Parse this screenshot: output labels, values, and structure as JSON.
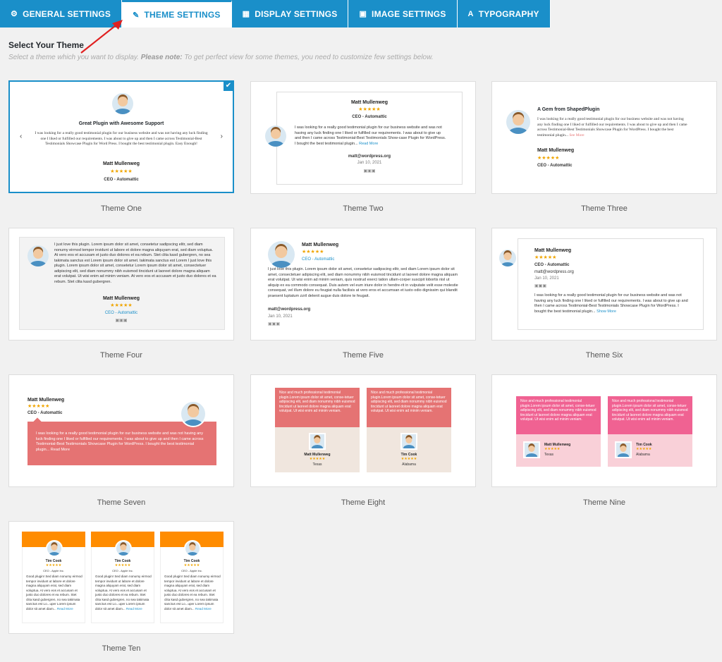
{
  "tabs": [
    {
      "label": "GENERAL SETTINGS",
      "icon": "gear-icon"
    },
    {
      "label": "THEME SETTINGS",
      "icon": "wand-icon"
    },
    {
      "label": "DISPLAY SETTINGS",
      "icon": "grid-icon"
    },
    {
      "label": "IMAGE SETTINGS",
      "icon": "image-icon"
    },
    {
      "label": "TYPOGRAPHY",
      "icon": "font-icon"
    }
  ],
  "section": {
    "title": "Select Your Theme",
    "desc_prefix": "Select a theme which you want to display.",
    "desc_bold": "Please note:",
    "desc_suffix": "To get perfect view for some themes, you need to customize few settings below."
  },
  "themes": [
    {
      "label": "Theme One",
      "title": "Great Plugin with Awesome Support",
      "text": "I was looking for a really good testimonial plugin for our business website and was not having any luck finding one I liked or fulfilled our requirements. I was about to give up and then I came across Testimonial-Best Testimonials Showcase Plugin for Word Press. I bought the best testimonial plugin. Easy Enough!",
      "name": "Matt Mullenweg",
      "role": "CEO - Automattic"
    },
    {
      "label": "Theme Two",
      "name": "Matt Mullenweg",
      "role": "CEO - Automattic",
      "text": "I was looking for a really good testimonial plugin for our business website and was not having any luck finding one I liked or fulfilled our requirements. I was about to give up and then I came across Testimonial-Best Testimonials Show-case Plugin for WordPress. I bought the best testimonial plugin...",
      "more": "Read More",
      "email": "matt@wordpress.org",
      "date": "Jan 10, 2021"
    },
    {
      "label": "Theme Three",
      "title": "A Gem from ShapedPlugin",
      "text": "I was looking for a really good testimonial plugin for our business website and was not having any luck finding one I liked or fulfilled our requirements. I was about to give up and then I came across Testimonial-Best Testimonials Showcase Plugin for WordPress. I bought the best testimonial plugin...",
      "more": "See More",
      "name": "Matt Mullenweg",
      "role": "CEO - Automattic"
    },
    {
      "label": "Theme Four",
      "text": "I just love this plugin. Lorem ipsum dolor sit amet, consetetur sadipscing elitr, sed diam nonumy eirmod tempor invidunt ut labore et dolore magna aliquyam erat, sed diam voluptua. At vero eos et accusam et justo duo dolores et ea rebum. Stet clita kasd gubergren, no sea takimata sanctus est Lorem ipsum dolor sit amet. takimata sanctus est Lorem I just love this plugin. Lorem ipsum dolor sit amet, consetetur Lorem ipsum dolor sit amet, consectetuer adipiscing elit, sed diam nonummy nibh euismod tincidunt ut laoreet dolore magna aliquam erat volutpat. Ut wisi enim ad minim veniam. At vero eos et accusam et justo duo dolores et ea rebum. Stet clita kasd gubergren.",
      "name": "Matt Mullenweg",
      "role": "CEO - Automattic"
    },
    {
      "label": "Theme Five",
      "name": "Matt Mullenweg",
      "role": "CEO - Automattic",
      "text": "I just love this plugin. Lorem ipsum dolor sit amet, consetetur sadipscing elitr, sed diam Lorem ipsum dolor sit amet, consectetuer adipiscing elit, sed diam nonummy nibh euismod tincidunt ut laoreet dolore magna aliquam erat volutpat. Ut wisi enim ad minim veniam, quis nostrud exerci tation ullam-corper suscipit lobortis nisl ut aliquip ex ea commodo consequat. Duis autem vel eum iriure dolor in hendre-rit in vulputate velit esse molestie consequat, vel illum dolore eu feugiat nulla facilisis at vero eros et accumsan et iusto odio dignissim qui blandit praesent luptatum zzril delenit augue duis dolore te feugait.",
      "email": "matt@wordpress.org",
      "date": "Jan 10, 2021"
    },
    {
      "label": "Theme Six",
      "name": "Matt Mullenweg",
      "role": "CEO - Automattic",
      "email": "matt@wordpress.org",
      "date": "Jan 10, 2021",
      "text": "I was looking for a really good testimonial plugin for our business website and was not having any luck finding one I liked or fulfilled our requirements. I was about to give up and then I came across Testimonial-Best Testimonials Showcase Plugin for WordPress. I bought the best testimonial plugin...",
      "more": "Show More"
    },
    {
      "label": "Theme Seven",
      "name": "Matt Mullenweg",
      "role": "CEO - Automattic",
      "text": "I was looking for a really good testimonial plugin for our business website and was not having any luck finding one I liked or fulfilled our requirements. I was about to give up and then I came across Testimonial-Best Testimonials Showcase Plugin for WordPress. I bought the best testimonial plugin...",
      "more": "Read More"
    },
    {
      "label": "Theme Eight",
      "quote": "Nice and much professional testimonial plugin.Lorem ipsum dolor sit amet, conse-tetuer adipiscing elit, sed diam nonummy nibh euismod tincidunt ut laoreet dolore magna aliquam erat volutpat. Ut wisi enim ad minim veniam.",
      "people": [
        {
          "name": "Matt Mullenweg",
          "loc": "Texas"
        },
        {
          "name": "Tim Cook",
          "loc": "Alabama"
        }
      ]
    },
    {
      "label": "Theme Nine",
      "quote": "Nice and much professional testimonial plugin.Lorem ipsum dolor sit amet, conse-tetuer adipiscing elit, sed diam nonummy nibh euismod tincidunt ut laoreet dolore magna aliquam erat volutpat. Ut wisi enim ad minim veniam.",
      "people": [
        {
          "name": "Matt Mullenweg",
          "loc": "Texas"
        },
        {
          "name": "Tim Cook",
          "loc": "Alabama"
        }
      ]
    },
    {
      "label": "Theme Ten",
      "name": "Tim Cook",
      "role": "CEO - Apple Inc.",
      "text": "Good plugin! Sed diam nonumy eirmod tempor invidunt ut labore et dolore magna aliquyam erat, sed diam voluptua. At vero eos et accusam et justo duo dolores et ea rebum. Stet clita kasd gubergren, no sea takimata sanctus est Lo...uper Lorem ipsum dolor sit amet diam...",
      "more": "Read More"
    }
  ],
  "colors": {
    "accent": "#1a8fc9",
    "stars": "#f0a500",
    "coral": "#e57373",
    "pink": "#f06292",
    "orange": "#ff8c00"
  }
}
